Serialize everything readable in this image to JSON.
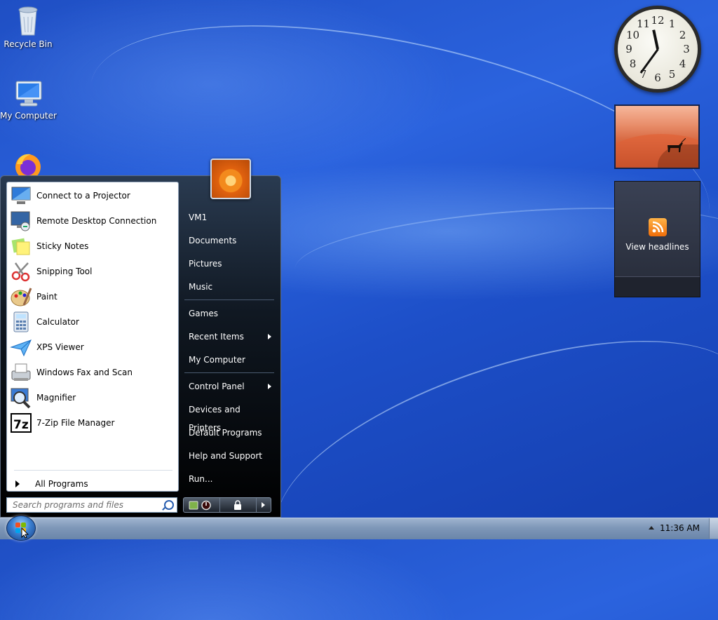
{
  "desktop": {
    "icons": [
      {
        "label": "Recycle Bin",
        "icon": "recycle-bin-icon"
      },
      {
        "label": "My Computer",
        "icon": "computer-icon"
      },
      {
        "label": "",
        "icon": "firefox-icon"
      }
    ]
  },
  "gadgets": {
    "clock": {
      "hours": 11,
      "minutes": 36,
      "numerals": [
        "12",
        "1",
        "2",
        "3",
        "4",
        "5",
        "6",
        "7",
        "8",
        "9",
        "10",
        "11"
      ]
    },
    "slideshow": {
      "icon": "photo-slideshow"
    },
    "feed": {
      "label": "View headlines",
      "icon": "rss-icon"
    }
  },
  "start_menu": {
    "programs": [
      {
        "label": "Connect to a Projector",
        "icon": "projector-icon"
      },
      {
        "label": "Remote Desktop Connection",
        "icon": "remote-desktop-icon"
      },
      {
        "label": "Sticky Notes",
        "icon": "sticky-notes-icon"
      },
      {
        "label": "Snipping Tool",
        "icon": "scissors-icon"
      },
      {
        "label": "Paint",
        "icon": "paint-palette-icon"
      },
      {
        "label": "Calculator",
        "icon": "calculator-icon"
      },
      {
        "label": "XPS Viewer",
        "icon": "paper-plane-icon"
      },
      {
        "label": "Windows Fax and Scan",
        "icon": "fax-icon"
      },
      {
        "label": "Magnifier",
        "icon": "magnifier-icon"
      },
      {
        "label": "7-Zip File Manager",
        "icon": "7zip-icon"
      }
    ],
    "all_programs": "All Programs",
    "search_placeholder": "Search programs and files",
    "right_items": [
      {
        "label": "VM1",
        "submenu": false
      },
      {
        "label": "Documents",
        "submenu": false
      },
      {
        "label": "Pictures",
        "submenu": false
      },
      {
        "label": "Music",
        "submenu": false
      },
      {
        "label": "Games",
        "submenu": false
      },
      {
        "label": "Recent Items",
        "submenu": true
      },
      {
        "label": "My Computer",
        "submenu": false
      },
      {
        "label": "Control Panel",
        "submenu": true
      },
      {
        "label": "Devices and Printers",
        "submenu": false
      },
      {
        "label": "Default Programs",
        "submenu": false
      },
      {
        "label": "Help and Support",
        "submenu": false
      },
      {
        "label": "Run...",
        "submenu": false
      }
    ]
  },
  "taskbar": {
    "time": "11:36 AM"
  },
  "colors": {
    "desktop_blue": "#2b63de",
    "taskbar": "#7e97b8"
  }
}
